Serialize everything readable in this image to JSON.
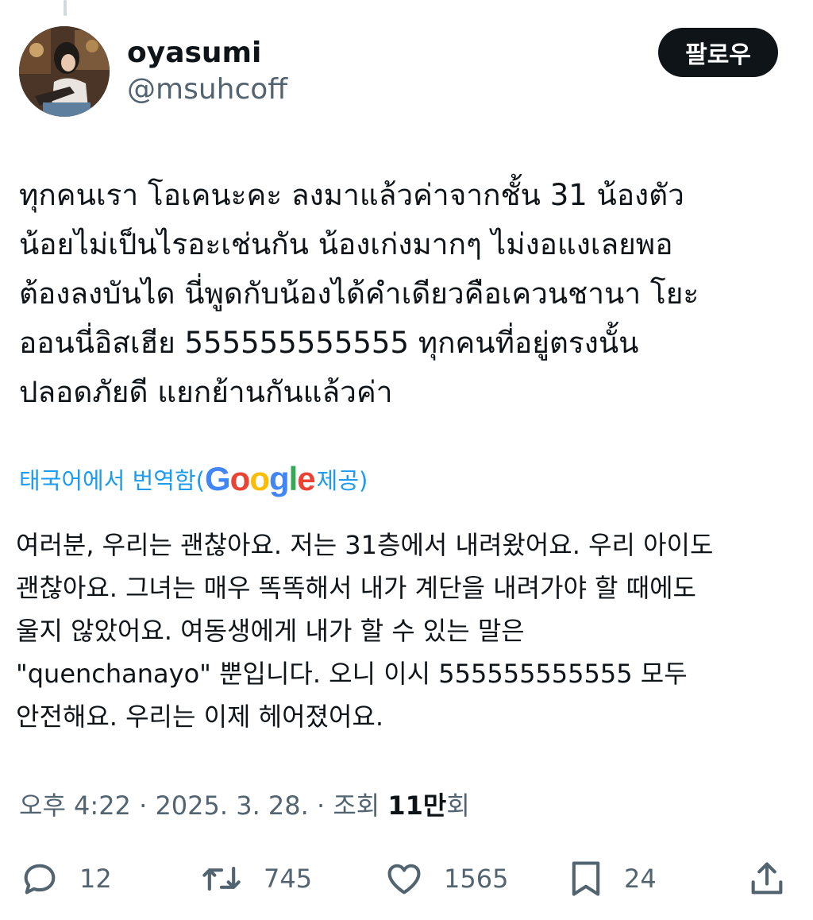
{
  "author": {
    "display_name": "oyasumi",
    "handle": "@msuhcoff",
    "follow_label": "팔로우"
  },
  "tweet": {
    "text": "ทุกคนเรา โอเคนะคะ ลงมาแล้วค่าจากชั้น 31 น้องตัว\nน้อยไม่เป็นไรอะเช่นกัน น้องเก่งมากๆ ไม่งอแงเลยพอ\nต้องลงบันได นี่พูดกับน้องได้คำเดียวคือเควนชานา โยะ\nออนนี่อิสเฮีย 555555555555 ทุกคนที่อยู่ตรงนั้น\nปลอดภัยดี แยกย้านกันแล้วค่า"
  },
  "translation": {
    "label_prefix": "태국어에서 번역함(",
    "provider": "Google",
    "label_suffix": " 제공)",
    "text": "여러분, 우리는 괜찮아요. 저는 31층에서 내려왔어요. 우리 아이도\n괜찮아요. 그녀는 매우 똑똑해서 내가 계단을 내려가야 할 때에도\n울지 않았어요. 여동생에게 내가 할 수 있는 말은\n\"quenchanayo\" 뿐입니다. 오니 이시 555555555555 모두\n안전해요. 우리는 이제 헤어졌어요."
  },
  "meta": {
    "time": "오후 4:22",
    "separator": " · ",
    "date": "2025. 3. 28.",
    "views_prefix": "조회 ",
    "views_count": "11만",
    "views_suffix": "회"
  },
  "actions": {
    "replies": "12",
    "reposts": "745",
    "likes": "1565",
    "bookmarks": "24"
  },
  "colors": {
    "text_primary": "#0f1419",
    "text_secondary": "#536471",
    "link_blue": "#1d9bf0",
    "button_bg": "#0f1419"
  },
  "icons": [
    "reply-icon",
    "repost-icon",
    "like-icon",
    "bookmark-icon",
    "share-icon"
  ]
}
